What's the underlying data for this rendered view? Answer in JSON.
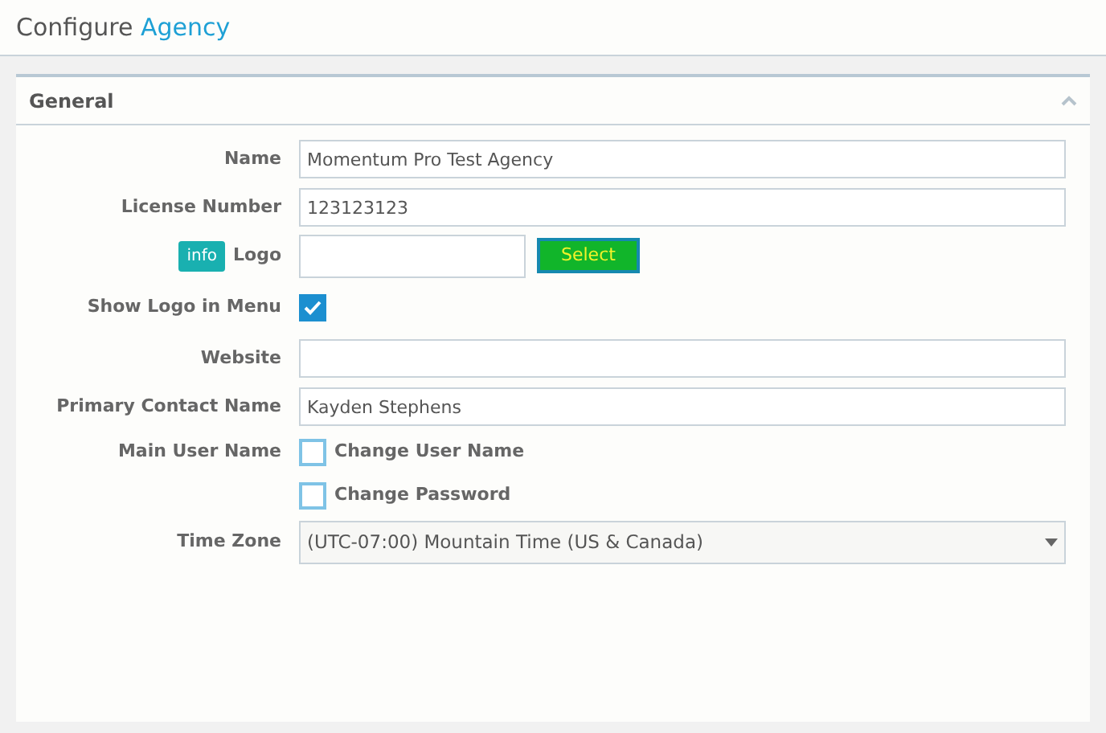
{
  "page_title": {
    "text": "Configure",
    "highlight": "Agency"
  },
  "panel": {
    "title": "General",
    "expanded": true
  },
  "fields": [
    {
      "kind": "text",
      "label": "Name",
      "value": "Momentum Pro Test Agency"
    },
    {
      "kind": "text",
      "label": "License Number",
      "value": "123123123"
    },
    {
      "kind": "file",
      "label": "Logo",
      "badge": "info",
      "button": "Select"
    },
    {
      "kind": "checkbox",
      "label": "Show Logo in Menu",
      "checked": true
    },
    {
      "kind": "text",
      "label": "Website"
    },
    {
      "kind": "text",
      "label": "Primary Contact Name",
      "value": "Kayden Stephens"
    },
    {
      "kind": "checkbox",
      "label": "Main User Name",
      "option": "Change User Name",
      "checked": false
    },
    {
      "kind": "checkbox",
      "option": "Change Password",
      "checked": false
    },
    {
      "kind": "select",
      "label": "Time Zone",
      "value": "(UTC-07:00) Mountain Time (US & Canada)"
    }
  ]
}
